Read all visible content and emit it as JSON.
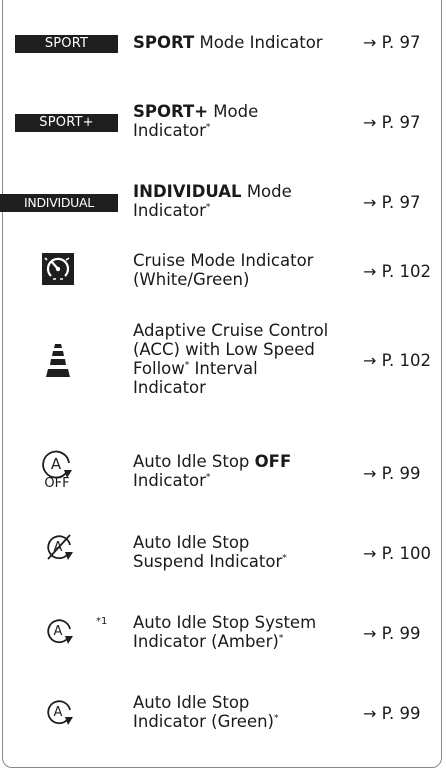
{
  "rows": [
    {
      "badge": "SPORT",
      "title_bold": "SPORT",
      "title_rest": " Mode Indicator",
      "page": "P. 97"
    },
    {
      "badge": "SPORT+",
      "title_bold": "SPORT+",
      "title_rest": " Mode",
      "title_line2": "Indicator",
      "asterisk": "*",
      "page": "P. 97"
    },
    {
      "badge": "INDIVIDUAL",
      "title_bold": "INDIVIDUAL",
      "title_rest": " Mode",
      "title_line2": "Indicator",
      "asterisk": "*",
      "page": "P. 97"
    },
    {
      "icon": "cruise-speedometer-icon",
      "line1": "Cruise Mode Indicator",
      "line2": "(White/Green)",
      "page": "P. 102"
    },
    {
      "icon": "acc-distance-bars-icon",
      "line1": "Adaptive Cruise Control",
      "line2": "(ACC) with Low Speed",
      "line3a": "Follow",
      "asterisk": "*",
      "line3b": " Interval",
      "line4": "Indicator",
      "page": "P. 102"
    },
    {
      "icon": "auto-idle-stop-off-icon",
      "icon_caption": "OFF",
      "line1a": "Auto Idle Stop ",
      "line1b": "OFF",
      "line2": "Indicator",
      "asterisk": "*",
      "page": "P. 99"
    },
    {
      "icon": "auto-idle-stop-suspend-icon",
      "line1": "Auto Idle Stop",
      "line2": "Suspend Indicator",
      "asterisk": "*",
      "page": "P. 100"
    },
    {
      "icon": "auto-idle-stop-system-icon",
      "footnote": "*1",
      "line1": "Auto Idle Stop System",
      "line2": "Indicator (Amber)",
      "asterisk": "*",
      "page": "P. 99"
    },
    {
      "icon": "auto-idle-stop-icon",
      "line1": "Auto Idle Stop",
      "line2": "Indicator (Green)",
      "asterisk": "*",
      "page": "P. 99"
    }
  ],
  "arrow": "→"
}
